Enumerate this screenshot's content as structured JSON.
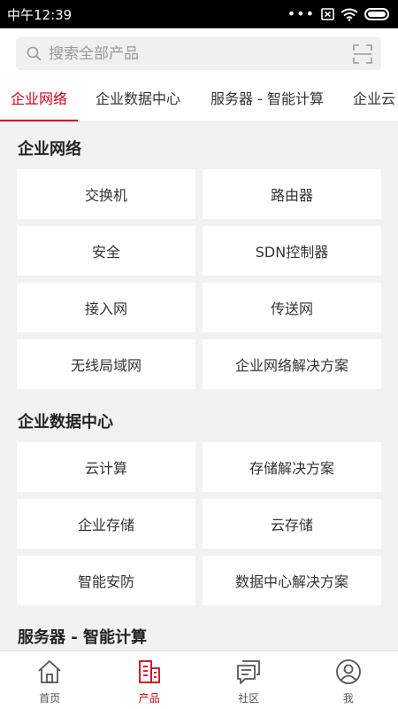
{
  "status": {
    "time": "中午12:39",
    "dots": "•••"
  },
  "search": {
    "placeholder": "搜索全部产品"
  },
  "tabs": [
    "企业网络",
    "企业数据中心",
    "服务器 - 智能计算",
    "企业云"
  ],
  "sections": [
    {
      "title": "企业网络",
      "items": [
        "交换机",
        "路由器",
        "安全",
        "SDN控制器",
        "接入网",
        "传送网",
        "无线局域网",
        "企业网络解决方案"
      ]
    },
    {
      "title": "企业数据中心",
      "items": [
        "云计算",
        "存储解决方案",
        "企业存储",
        "云存储",
        "智能安防",
        "数据中心解决方案"
      ]
    },
    {
      "title": "服务器 - 智能计算",
      "items": []
    }
  ],
  "nav": [
    {
      "label": "首页",
      "icon": "home-icon"
    },
    {
      "label": "产品",
      "icon": "products-icon"
    },
    {
      "label": "社区",
      "icon": "community-icon"
    },
    {
      "label": "我",
      "icon": "profile-icon"
    }
  ],
  "colors": {
    "accent": "#d0021b",
    "background": "#f2f2f2"
  }
}
